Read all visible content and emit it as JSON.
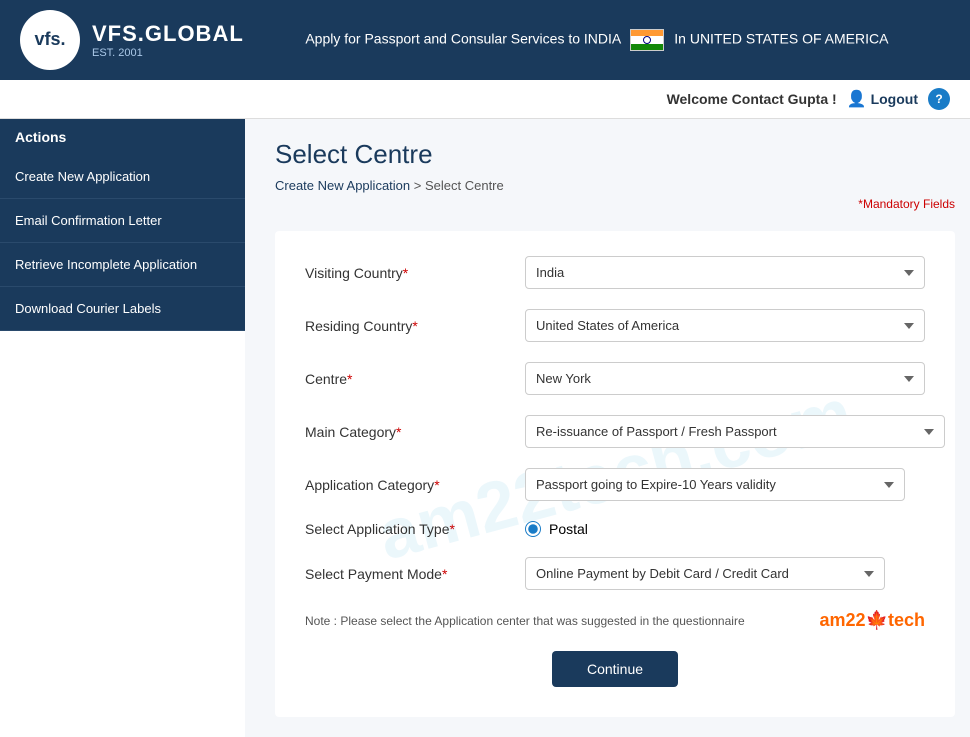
{
  "header": {
    "logo_text": "vfs.",
    "logo_brand": "VFS.GLOBAL",
    "logo_est": "EST. 2001",
    "tagline": "Apply for Passport and Consular Services to INDIA",
    "country": "In UNITED STATES OF AMERICA"
  },
  "topbar": {
    "welcome": "Welcome Contact Gupta !",
    "logout": "Logout",
    "help": "?"
  },
  "sidebar": {
    "header": "Actions",
    "items": [
      {
        "label": "Create New Application"
      },
      {
        "label": "Email Confirmation Letter"
      },
      {
        "label": "Retrieve Incomplete Application"
      },
      {
        "label": "Download Courier Labels"
      }
    ]
  },
  "page": {
    "title": "Select Centre",
    "breadcrumb_home": "Create New Application",
    "breadcrumb_sep": ">",
    "breadcrumb_current": "Select Centre",
    "mandatory_note": "*Mandatory Fields"
  },
  "form": {
    "watermark": "am22tech.com",
    "visiting_country_label": "Visiting Country",
    "visiting_country_value": "India",
    "residing_country_label": "Residing Country",
    "residing_country_value": "United States of America",
    "centre_label": "Centre",
    "centre_value": "New York",
    "main_category_label": "Main Category",
    "main_category_value": "Re-issuance of Passport / Fresh Passport",
    "app_category_label": "Application Category",
    "app_category_value": "Passport going to Expire-10 Years validity",
    "app_type_label": "Select Application Type",
    "app_type_value": "Postal",
    "payment_mode_label": "Select Payment Mode",
    "payment_mode_value": "Online Payment by Debit Card / Credit Card",
    "note_text": "Note : Please select the Application center that was suggested in the questionnaire",
    "brand_text": "am22",
    "brand_icon": "🍁",
    "brand_text2": "tech",
    "continue_label": "Continue",
    "visiting_countries": [
      "India"
    ],
    "residing_countries": [
      "United States of America"
    ],
    "centres": [
      "New York"
    ],
    "main_categories": [
      "Re-issuance of Passport / Fresh Passport"
    ],
    "app_categories": [
      "Passport going to Expire-10 Years validity"
    ],
    "payment_modes": [
      "Online Payment by Debit Card / Credit Card"
    ]
  }
}
